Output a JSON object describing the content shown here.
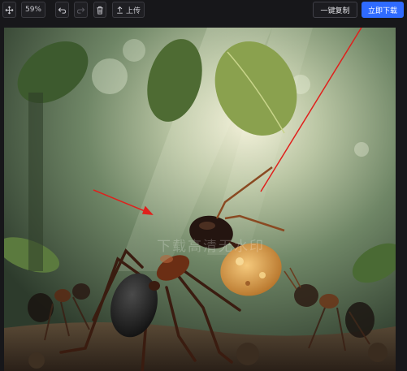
{
  "toolbar": {
    "zoom": "59%",
    "upload_label": "上传",
    "copy_label": "一键复制",
    "download_label": "立即下载"
  },
  "icons": {
    "move": "move-icon",
    "undo": "undo-icon",
    "redo": "redo-icon",
    "delete": "trash-icon",
    "upload": "upload-icon"
  },
  "canvas": {
    "watermark": "下载高清无水印"
  },
  "colors": {
    "primary": "#2f6bff",
    "background": "#17171a",
    "annotation_arrow": "#e0201c"
  }
}
